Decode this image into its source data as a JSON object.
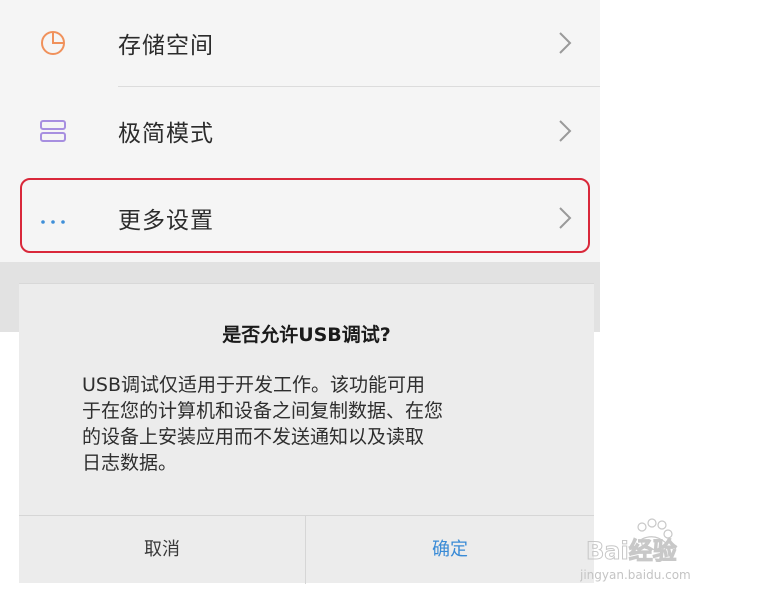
{
  "settings": {
    "items": [
      {
        "label": "存储空间",
        "icon": "pie-chart-icon",
        "color": "#f0915b"
      },
      {
        "label": "极简模式",
        "icon": "layout-icon",
        "color": "#a78fe0"
      },
      {
        "label": "更多设置",
        "icon": "more-icon",
        "color": "#3e8fd8"
      }
    ],
    "highlight_color": "#d9283a"
  },
  "dialog": {
    "title": "是否允许USB调试?",
    "body_lines": [
      "USB调试仅适用于开发工作。该功能可用",
      "于在您的计算机和设备之间复制数据、在您",
      "的设备上安装应用而不发送通知以及读取",
      "日志数据。"
    ],
    "cancel_label": "取消",
    "confirm_label": "确定",
    "confirm_color": "#3a8bd6"
  },
  "watermark": {
    "brand_text": "Bai经验",
    "url_text": "jingyan.baidu.com"
  }
}
